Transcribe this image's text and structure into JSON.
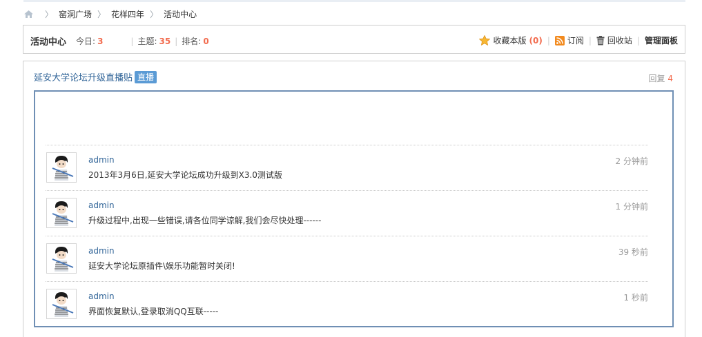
{
  "breadcrumb": {
    "items": [
      "窑洞广场",
      "花样四年",
      "活动中心"
    ]
  },
  "forum_header": {
    "title": "活动中心",
    "today_label": "今日:",
    "today_value": "3",
    "topics_label": "主题:",
    "topics_value": "35",
    "rank_label": "排名:",
    "rank_value": "0",
    "favorite_label": "收藏本版",
    "favorite_count": "(0)",
    "subscribe_label": "订阅",
    "recycle_label": "回收站",
    "admin_label": "管理面板"
  },
  "thread": {
    "title": "延安大学论坛升级直播贴",
    "badge": "直播",
    "replies_label": "回复",
    "replies_count": "4"
  },
  "posts": [
    {
      "user": "admin",
      "time": "2 分钟前",
      "text": "2013年3月6日,延安大学论坛成功升级到X3.0测试版"
    },
    {
      "user": "admin",
      "time": "1 分钟前",
      "text": "升级过程中,出现一些错误,请各位同学谅解,我们会尽快处理------"
    },
    {
      "user": "admin",
      "time": "39 秒前",
      "text": "延安大学论坛原插件\\娱乐功能暂时关闭!"
    },
    {
      "user": "admin",
      "time": "1 秒前",
      "text": "界面恢复默认,登录取消QQ互联-----"
    }
  ],
  "colors": {
    "accent_number": "#f26c4f",
    "link": "#336699",
    "badge": "#5b9bd5",
    "live_border": "#6f8fb4"
  }
}
